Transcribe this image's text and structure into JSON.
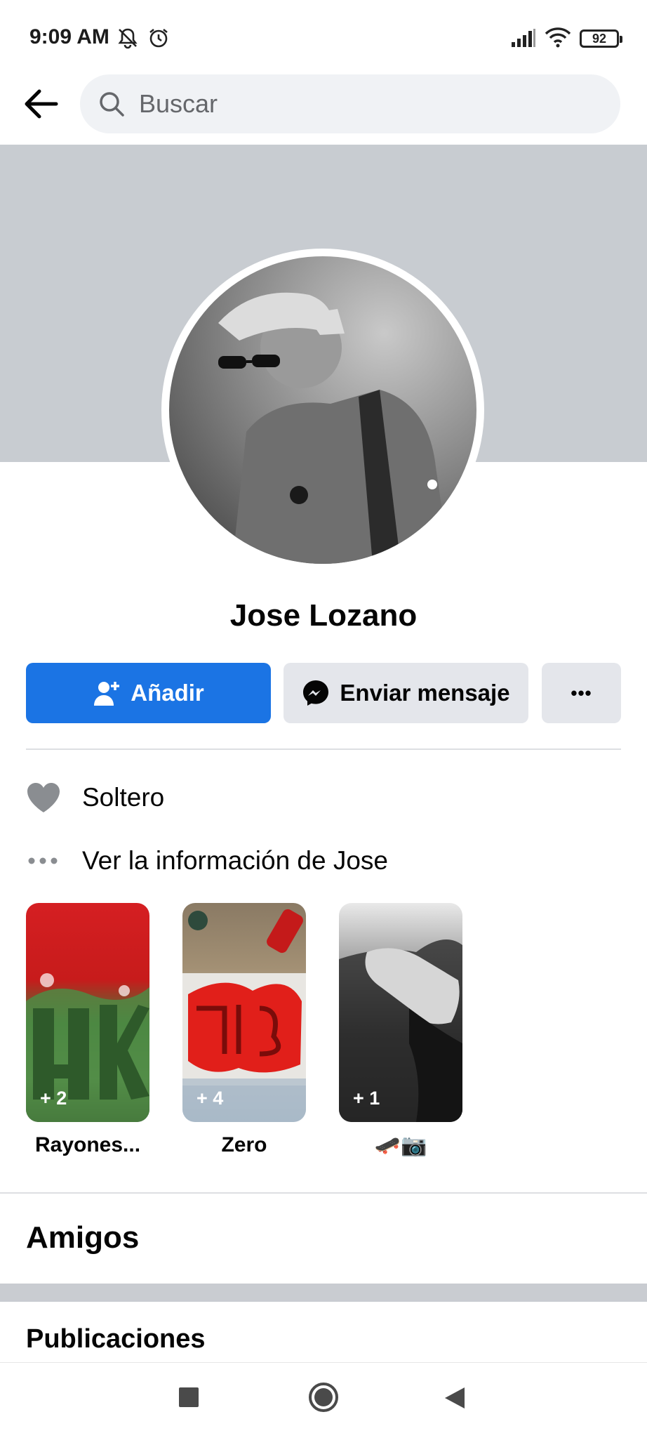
{
  "status_bar": {
    "time": "9:09 AM",
    "battery": "92"
  },
  "search": {
    "placeholder": "Buscar"
  },
  "profile": {
    "name": "Jose Lozano"
  },
  "actions": {
    "add_label": "Añadir",
    "message_label": "Enviar mensaje",
    "more_label": "•••"
  },
  "info": {
    "relationship": "Soltero",
    "see_info": "Ver la información de Jose"
  },
  "highlights": [
    {
      "title": "Rayones...",
      "count": "+ 2"
    },
    {
      "title": "Zero",
      "count": "+ 4"
    },
    {
      "title": "🛹📷",
      "count": "+ 1"
    }
  ],
  "sections": {
    "friends": "Amigos",
    "posts": "Publicaciones"
  },
  "colors": {
    "primary": "#1b74e4",
    "secondary_button": "#e4e6eb",
    "cover": "#c8ccd1"
  }
}
